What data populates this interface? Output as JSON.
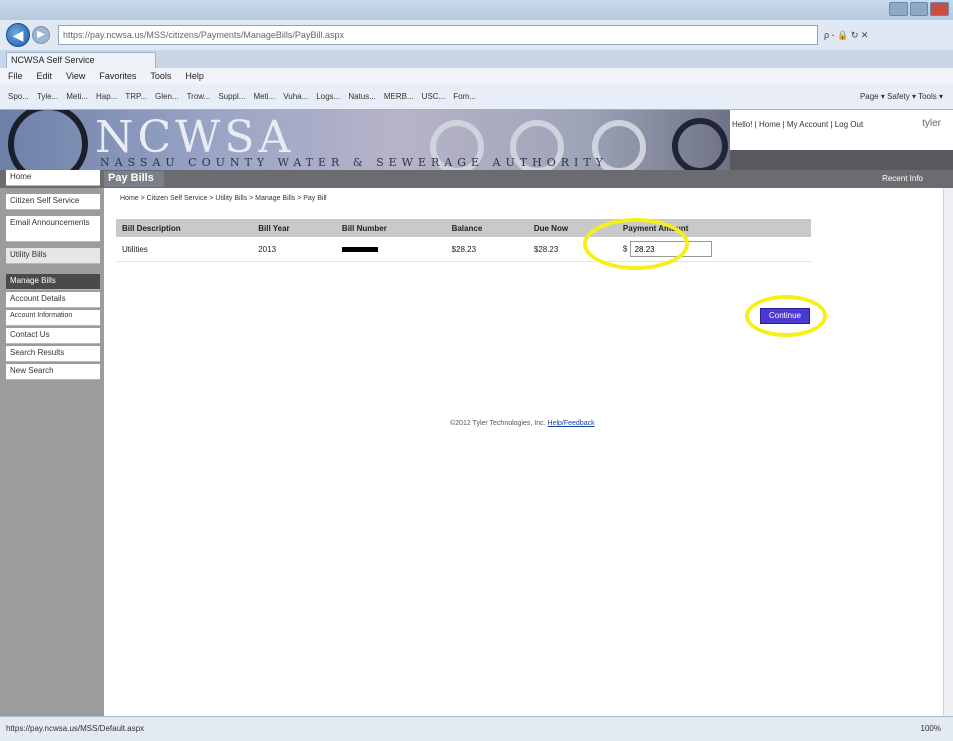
{
  "browser": {
    "address": "https://pay.ncwsa.us/MSS/citizens/Payments/ManageBills/PayBill.aspx",
    "address_tools": "ρ - 🔒 ↻ ✕",
    "tab_title": "NCWSA Self Service",
    "menu": [
      "File",
      "Edit",
      "View",
      "Favorites",
      "Tools",
      "Help"
    ],
    "favorites": [
      "Spo...",
      "Tyle...",
      "Meti...",
      "Hap...",
      "TRP...",
      "Glen...",
      "Trow...",
      "Suppl...",
      "Meti...",
      "Vuha...",
      "Logs...",
      "Natus...",
      "MERB...",
      "USC...",
      "Fom..."
    ],
    "command_bar": "Page ▾  Safety ▾  Tools ▾",
    "status_url": "https://pay.ncwsa.us/MSS/Default.aspx",
    "zoom": "100%"
  },
  "site": {
    "logo_letters": "NCWSA",
    "logo_sub": "NASSAU COUNTY WATER & SEWERAGE AUTHORITY",
    "top_links": "Hello! | Home | My Account | Log Out",
    "brand": "tyler",
    "page_title": "Pay Bills",
    "right_link": "Recent Info"
  },
  "sidebar": {
    "items": [
      {
        "label": "Home",
        "type": "item"
      },
      {
        "label": "Citizen Self Service",
        "type": "item"
      },
      {
        "label": "Email Announcements",
        "type": "item"
      },
      {
        "label": "Utility Bills",
        "type": "hdr"
      },
      {
        "label": "Manage Bills",
        "type": "sel"
      },
      {
        "label": "Account Details",
        "type": "item"
      },
      {
        "label": "Account Information",
        "type": "item"
      },
      {
        "label": "Contact Us",
        "type": "item"
      },
      {
        "label": "Search Results",
        "type": "item"
      },
      {
        "label": "New Search",
        "type": "item"
      }
    ]
  },
  "breadcrumb": "Home > Citizen Self Service > Utility Bills > Manage Bills > Pay Bill",
  "table": {
    "headers": [
      "Bill Description",
      "Bill Year",
      "Bill Number",
      "Balance",
      "Due Now",
      "Payment Amount"
    ],
    "row": {
      "description": "Utilities",
      "year": "2013",
      "number_redacted": true,
      "balance": "$28.23",
      "due_now": "$28.23",
      "currency": "$",
      "payment_amount": "28.23"
    }
  },
  "continue_label": "Continue",
  "footer": {
    "text": "©2012 Tyler Technologies, Inc. ",
    "link": "Help/Feedback"
  },
  "colors": {
    "highlight": "#f5ef1a",
    "continue_button": "#4a3bd0",
    "sidebar": "#9c9c9c"
  }
}
